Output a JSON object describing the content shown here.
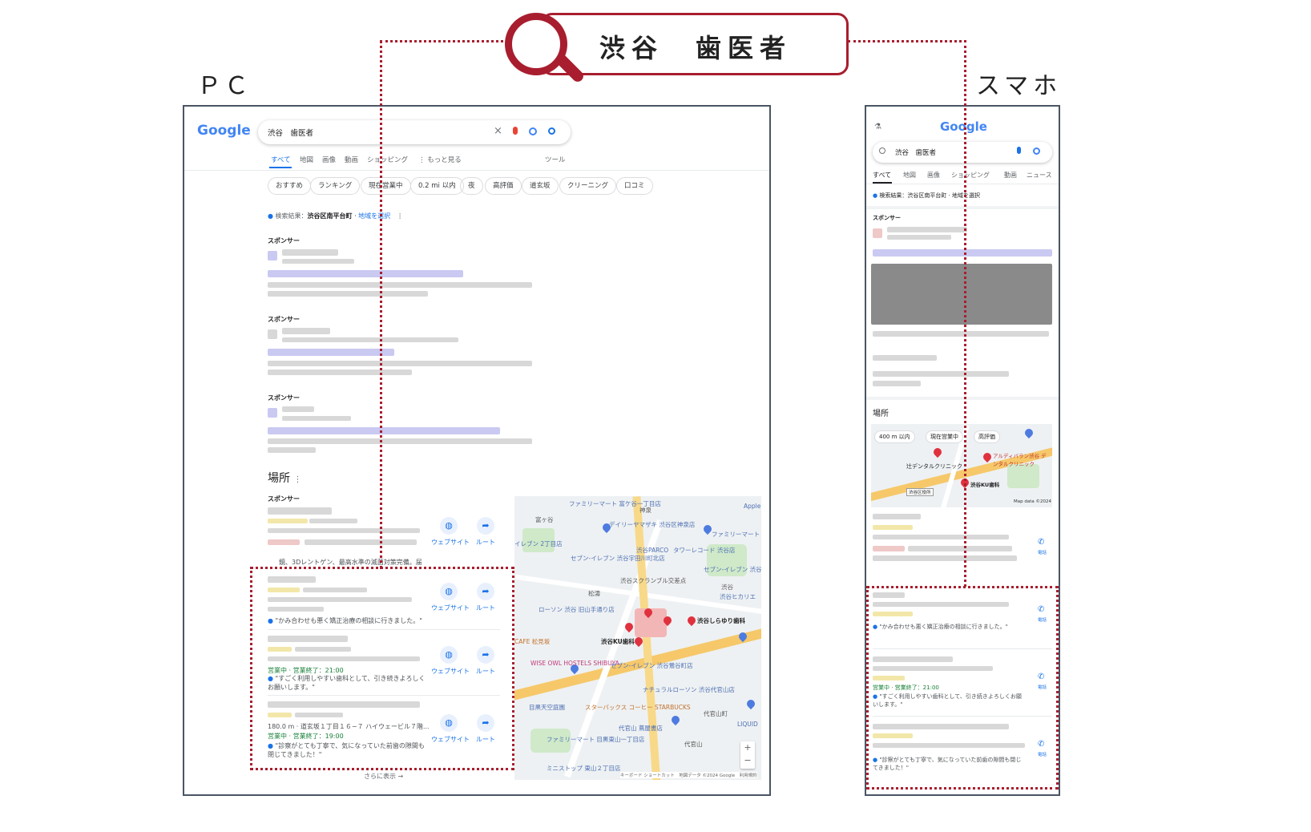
{
  "search_term": "渋谷　歯医者",
  "label_pc": "ＰＣ",
  "label_sp": "スマホ",
  "pc": {
    "logo": "Google",
    "query": "渋谷　歯医者",
    "tabs": [
      "すべて",
      "地図",
      "画像",
      "動画",
      "ショッピング",
      "⋮ もっと見る"
    ],
    "tools": "ツール",
    "chips": [
      "おすすめ",
      "ランキング",
      "現在営業中",
      "0.2 mi 以内",
      "夜",
      "高評価",
      "道玄坂",
      "クリーニング",
      "口コミ"
    ],
    "result_loc_prefix": "検索結果：",
    "result_loc": "渋谷区南平台町",
    "result_loc_link": "地域を選択",
    "sponsor": "スポンサー",
    "places": "場所",
    "website": "ウェブサイト",
    "route": "ルート",
    "ad_snippet": "鏡、3Dレントゲン、最高水準の滅菌対策完備。届",
    "r1_review": "\"かみ合わせも悪く矯正治療の相談に行きました。\"",
    "r2_hours": "営業中 · 営業終了：21:00",
    "r2_review": "\"すごく利用しやすい歯科として、引き続きよろしくお願いします。\"",
    "r3_addr": "180.0 m · 道玄坂１丁目１６−７ ハイウェービル７階...",
    "r3_hours": "営業中 · 営業終了：19:00",
    "r3_review": "\"診察がとても丁寧で、気になっていた前歯の隙間も閉じてきました！\"",
    "more": "さらに表示 →",
    "map_footer": "キーボード ショートカット　地図データ ©2024 Google　利用規約",
    "map_labels": [
      "ファミリーマート 富ケ谷一丁目店",
      "神泉",
      "デイリーヤマザキ 渋谷区神泉店",
      "ファミリーマート オーバル",
      "セブン-イレブン 渋谷宇田川町北店",
      "渋谷PARCO",
      "タワーレコード 渋谷店",
      "渋谷スクランブル交差点",
      "松濤",
      "セブン-イレブン 渋谷金王坂上店",
      "渋谷",
      "渋谷ヒカリエ",
      "ローソン 渋谷 旧山手通り店",
      "渋谷しらゆり歯科",
      "渋谷KU歯科",
      "CAFE 松見坂",
      "WISE OWL HOSTELS SHIBUYA",
      "セブン-イレブン 渋谷鶯谷町店",
      "ナチュラルローソン 渋谷代官山店",
      "スターバックス コーヒー STARBUCKS",
      "代官山 蔦屋書店",
      "代官山町",
      "ファミリーマート 目黒東山一丁目店",
      "ミニストップ 東山２丁目店",
      "Apple",
      "富ヶ谷",
      "イレブン 2丁目店",
      "目黒天空庭園",
      "LIQUID",
      "代官山"
    ]
  },
  "sp": {
    "logo": "Google",
    "query": "渋谷　歯医者",
    "tabs": [
      "すべて",
      "地図",
      "画像",
      "ショッピング",
      "動画",
      "ニュース"
    ],
    "result_loc": "検索結果：渋谷区南平台町 · 地域を選択",
    "sponsor": "スポンサー",
    "places": "場所",
    "chips": [
      "400 m 以内",
      "現在営業中",
      "高評価"
    ],
    "map_labels": [
      "辻デンタルクリニック",
      "アルディバラン渋谷 デンタルクリニック",
      "渋谷KU歯科",
      "渋谷区役所",
      "Map data ©2024"
    ],
    "call": "電話",
    "r1_review": "\"かみ合わせも悪く矯正治療の相談に行きました。\"",
    "r2_hours": "営業中 · 営業終了：21:00",
    "r2_review": "\"すごく利用しやすい歯科として、引き続きよろしくお願いします。\"",
    "r3_review": "\"診察がとても丁寧で、気になっていた前歯の隙間も閉じてきました！\""
  }
}
